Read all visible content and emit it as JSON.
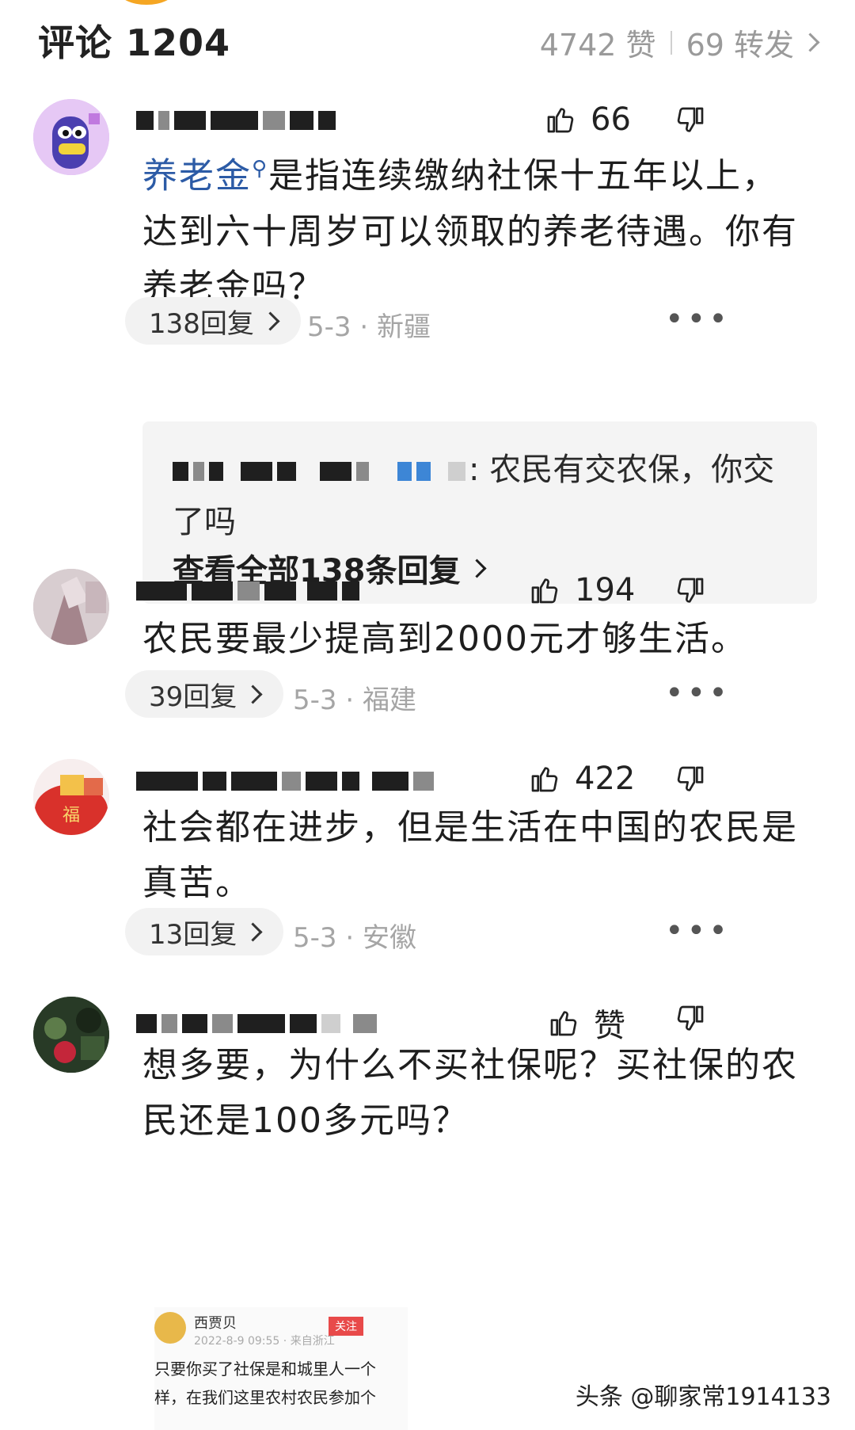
{
  "header": {
    "title": "评论 1204",
    "likes": "4742 赞",
    "shares": "69 转发"
  },
  "comments": [
    {
      "likes": "66",
      "text_keyword": "养老金",
      "text_rest": "是指连续缴纳社保十五年以上，达到六十周岁可以领取的养老待遇。你有养老金吗？",
      "replies": "138回复",
      "meta": "5-3 · 新疆",
      "sub_reply_text": ": 农民有交农保，你交了吗",
      "view_all": "查看全部138条回复"
    },
    {
      "likes": "194",
      "text": "农民要最少提高到2000元才够生活。",
      "replies": "39回复",
      "meta": "5-3 · 福建"
    },
    {
      "likes": "422",
      "text": "社会都在进步，但是生活在中国的农民是真苦。",
      "replies": "13回复",
      "meta": "5-3 · 安徽"
    },
    {
      "likes": "赞",
      "text": "想多要，为什么不买社保呢？买社保的农民还是100多元吗？"
    }
  ],
  "embedded_image": {
    "name": "西贾贝",
    "meta": "2022-8-9 09:55 · 来自浙江",
    "follow": "关注",
    "line1": "只要你买了社保是和城里人一个",
    "line2": "样，在我们这里农村农民参加个"
  },
  "avatar4_badge": "福",
  "watermark": "头条 @聊家常1914133",
  "colors": {
    "keyword_blue": "#2c5ba6",
    "meta_gray": "#a5a5a5",
    "pill_bg": "#f2f2f2"
  }
}
